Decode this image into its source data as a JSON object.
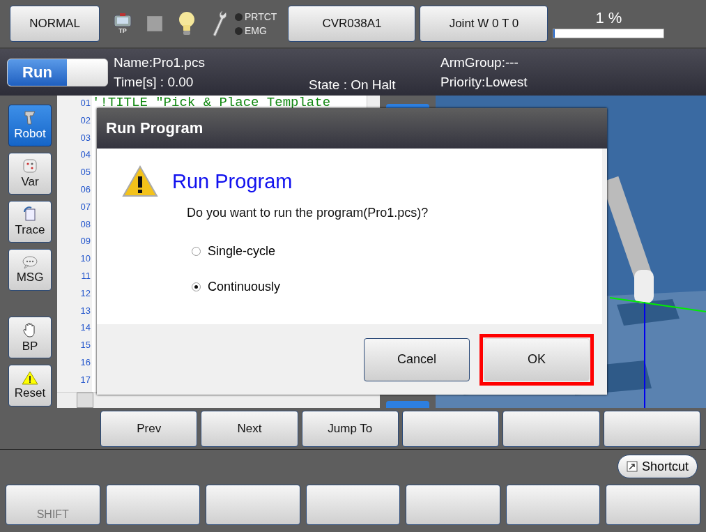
{
  "top_bar": {
    "mode_button": "NORMAL",
    "tp_label": "TP",
    "indicators": [
      {
        "label": "PRTCT",
        "lit": false
      },
      {
        "label": "EMG",
        "lit": false
      }
    ],
    "controller_button": "CVR038A1",
    "jog_button": "Joint  W 0 T 0",
    "speed": {
      "reading": "1 %",
      "level": 0.01
    }
  },
  "info_bar": {
    "run_toggle": {
      "label": "Run",
      "on": true
    },
    "name": "Name:Pro1.pcs",
    "time": "Time[s] : 0.00",
    "state": "State : On Halt",
    "arm_group": "ArmGroup:---",
    "priority": "Priority:Lowest"
  },
  "sidebar": [
    {
      "label": "Robot",
      "selected": true
    },
    {
      "label": "Var",
      "selected": false
    },
    {
      "label": "Trace",
      "selected": false
    },
    {
      "label": "MSG",
      "selected": false
    },
    {
      "label": "BP",
      "selected": false
    },
    {
      "label": "Reset",
      "selected": false
    }
  ],
  "editor": {
    "line_numbers": [
      "01",
      "02",
      "03",
      "04",
      "05",
      "06",
      "07",
      "08",
      "09",
      "10",
      "11",
      "12",
      "13",
      "14",
      "15",
      "16",
      "17"
    ],
    "first_line": "'!TITLE \"Pick & Place Template"
  },
  "dialog": {
    "title": "Run Program",
    "heading": "Run Program",
    "message": "Do you want to run the program(Pro1.pcs)?",
    "options": [
      {
        "label": "Single-cycle",
        "selected": false
      },
      {
        "label": "Continuously",
        "selected": true
      }
    ],
    "buttons": [
      {
        "label": "Cancel",
        "highlighted": false
      },
      {
        "label": "OK",
        "highlighted": true
      }
    ]
  },
  "function_keys": [
    "Prev",
    "Next",
    "Jump To"
  ],
  "shortcut_button": "Shortcut",
  "bottom_keys": [
    "SHIFT"
  ]
}
